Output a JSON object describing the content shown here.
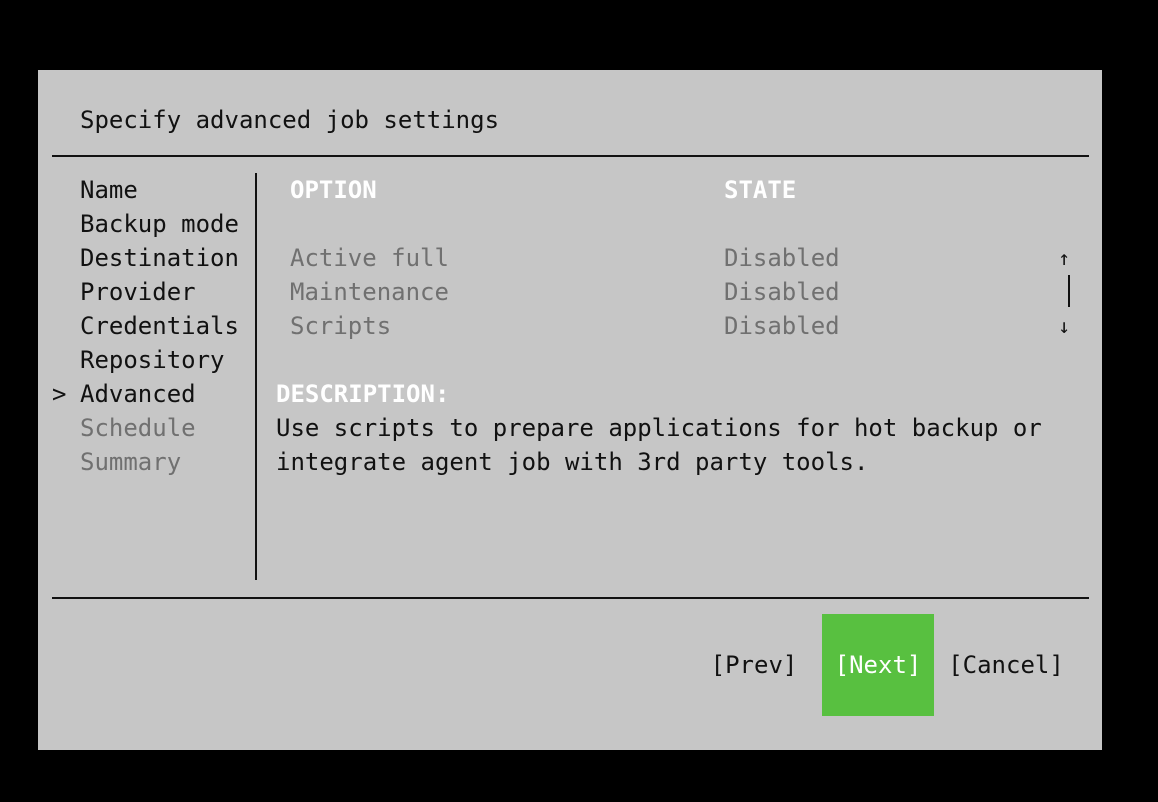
{
  "title": "Specify advanced job settings",
  "steps": [
    {
      "label": "Name",
      "state": "done"
    },
    {
      "label": "Backup mode",
      "state": "done"
    },
    {
      "label": "Destination",
      "state": "done"
    },
    {
      "label": "Provider",
      "state": "done"
    },
    {
      "label": "Credentials",
      "state": "done"
    },
    {
      "label": "Repository",
      "state": "done"
    },
    {
      "label": "Advanced",
      "state": "current"
    },
    {
      "label": "Schedule",
      "state": "future"
    },
    {
      "label": "Summary",
      "state": "future"
    }
  ],
  "current_marker": ">",
  "options_table": {
    "headers": {
      "option": "OPTION",
      "state": "STATE"
    },
    "rows": [
      {
        "option": "Active full",
        "state": "Disabled"
      },
      {
        "option": "Maintenance",
        "state": "Disabled"
      },
      {
        "option": "Scripts",
        "state": "Disabled"
      }
    ]
  },
  "scrollbar": {
    "up_glyph": "↑",
    "down_glyph": "↓"
  },
  "description": {
    "label": "DESCRIPTION:",
    "lines": [
      "Use scripts to prepare applications for hot backup or",
      "integrate agent job with 3rd party tools."
    ]
  },
  "buttons": {
    "prev": "[Prev]",
    "next": "[Next]",
    "cancel": "[Cancel]"
  },
  "colors": {
    "dialog_bg": "#c6c6c6",
    "accent_green": "#58c040",
    "header_text": "#ffffff",
    "muted_text": "#707070"
  }
}
